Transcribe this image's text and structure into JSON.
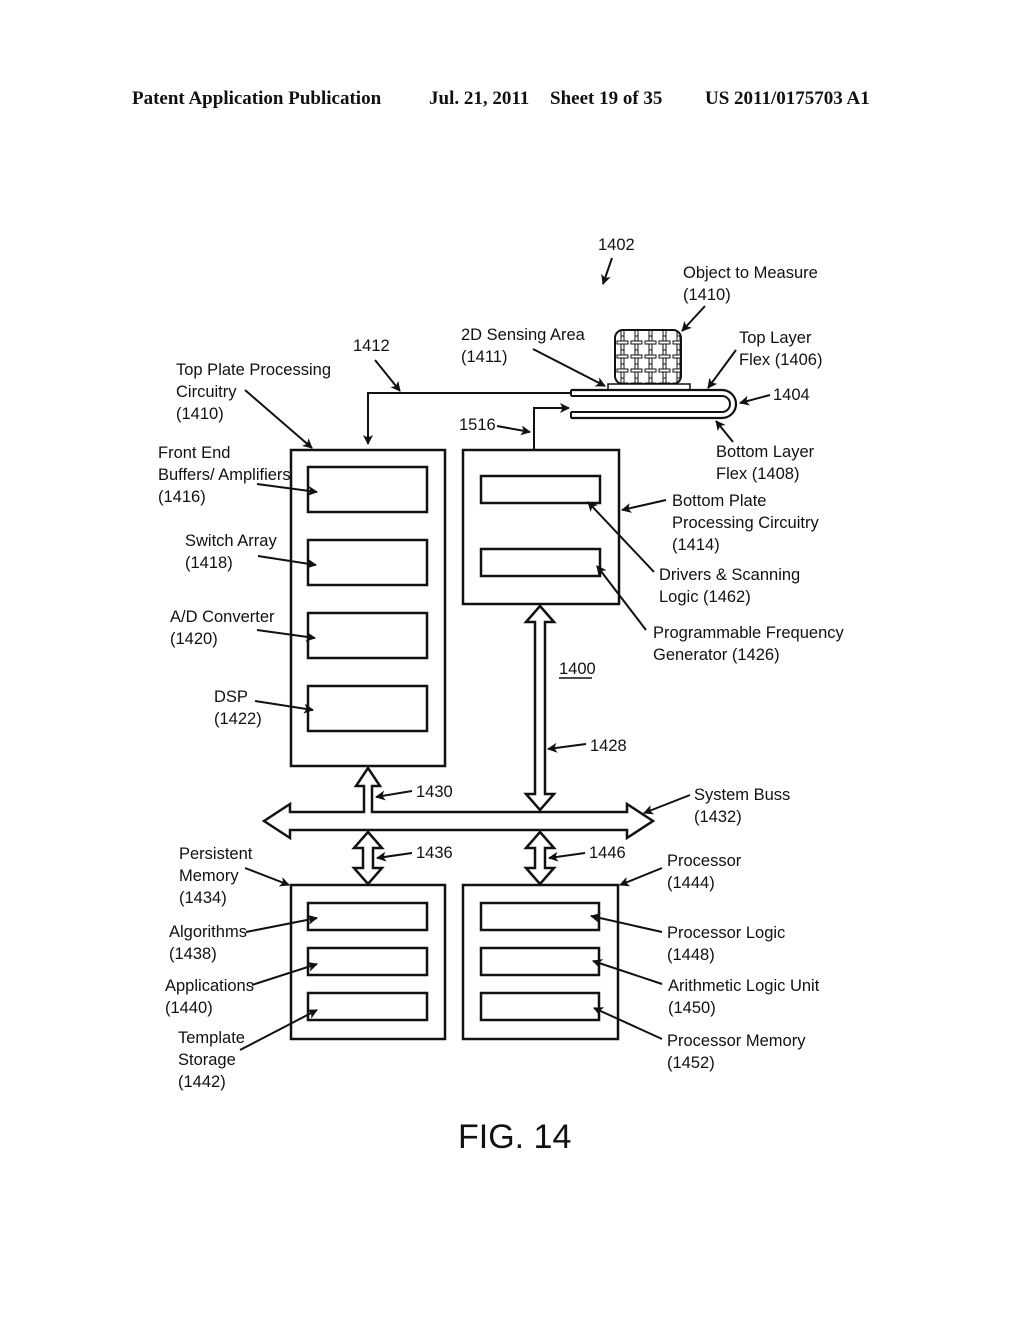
{
  "header": {
    "publication": "Patent Application Publication",
    "date": "Jul. 21, 2011",
    "sheet": "Sheet 19 of 35",
    "number": "US 2011/0175703 A1"
  },
  "figure": {
    "caption": "FIG. 14",
    "system_ref": "1400",
    "assembly_ref": "1402",
    "labels": {
      "object_to_measure": [
        "Object to Measure",
        "(1410)"
      ],
      "sensing_area": [
        "2D Sensing Area",
        "(1411)"
      ],
      "top_layer_flex": [
        "Top Layer",
        "Flex (1406)"
      ],
      "flex_ref": "1404",
      "bottom_layer_flex": [
        "Bottom Layer",
        "Flex (1408)"
      ],
      "ref_1412": "1412",
      "ref_1516": "1516",
      "top_plate": [
        "Top Plate Processing",
        "Circuitry",
        "(1410)"
      ],
      "front_end": [
        "Front End",
        "Buffers/ Amplifiers",
        "(1416)"
      ],
      "switch_array": [
        "Switch Array",
        "(1418)"
      ],
      "ad_converter": [
        "A/D Converter",
        "(1420)"
      ],
      "dsp": [
        "DSP",
        "(1422)"
      ],
      "bottom_plate": [
        "Bottom Plate",
        "Processing Circuitry",
        "(1414)"
      ],
      "drivers": [
        "Drivers & Scanning",
        "Logic (1462)"
      ],
      "freq_gen": [
        "Programmable Frequency",
        "Generator (1426)"
      ],
      "ref_1428": "1428",
      "ref_1430": "1430",
      "system_bus": [
        "System Buss",
        "(1432)"
      ],
      "ref_1436": "1436",
      "ref_1446": "1446",
      "persistent_memory": [
        "Persistent",
        "Memory",
        "(1434)"
      ],
      "algorithms": [
        "Algorithms",
        "(1438)"
      ],
      "applications": [
        "Applications",
        "(1440)"
      ],
      "template_storage": [
        "Template",
        "Storage",
        "(1442)"
      ],
      "processor": [
        "Processor",
        "(1444)"
      ],
      "processor_logic": [
        "Processor Logic",
        "(1448)"
      ],
      "alu": [
        "Arithmetic Logic Unit",
        "(1450)"
      ],
      "processor_memory": [
        "Processor Memory",
        "(1452)"
      ]
    }
  }
}
